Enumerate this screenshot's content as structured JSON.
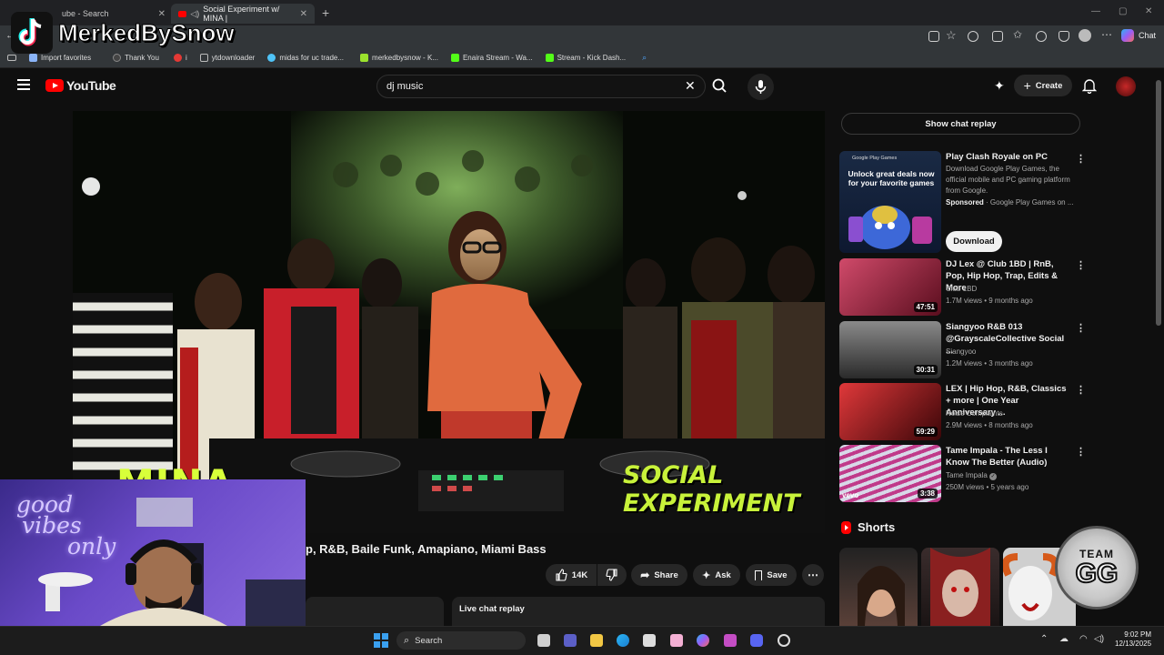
{
  "overlay": {
    "channel_name": "MerkedBySnow",
    "badge_line1": "TEAM",
    "badge_line2": "GG",
    "neon_line1": "good",
    "neon_line2": "vibes",
    "neon_line3": "only"
  },
  "browser": {
    "tabs": [
      {
        "label": "ube - Search"
      },
      {
        "label": "Social Experiment w/ MINA |"
      }
    ],
    "new_tab": "+",
    "chat_label": "Chat",
    "bookmarks": [
      {
        "label": "Import favorites",
        "color": "#8ab4f8"
      },
      {
        "label": "Thank You",
        "color": "#444444"
      },
      {
        "label": "i",
        "color": "#e53935"
      },
      {
        "label": "ytdownloader",
        "color": "#999999"
      },
      {
        "label": "midas for uc trade...",
        "color": "#4fc3f7"
      },
      {
        "label": "merkedbysnow - K...",
        "color": "#9be22d"
      },
      {
        "label": "Enaira Stream - Wa...",
        "color": "#53fc18"
      },
      {
        "label": "Stream - Kick Dash...",
        "color": "#53fc18"
      }
    ]
  },
  "youtube": {
    "logo_text": "YouTube",
    "search_value": "dj music",
    "create_label": "Create",
    "video_overlay_left": "MINA",
    "video_overlay_right": "SOCIAL EXPERIMENT",
    "video_title_partial": "p, R&B, Baile Funk, Amapiano, Miami Bass",
    "like_count": "14K",
    "share_label": "Share",
    "ask_label": "Ask",
    "save_label": "Save",
    "live_chat_replay": "Live chat replay",
    "show_chat_replay": "Show chat replay"
  },
  "ad": {
    "thumb_brand": "Google Play Games",
    "thumb_text": "Unlock great deals now for your favorite games",
    "title": "Play Clash Royale on PC",
    "description": "Download Google Play Games, the official mobile and PC gaming platform from Google.",
    "sponsored": "Sponsored",
    "advertiser": "· Google Play Games on ...",
    "button": "Download"
  },
  "recommendations": [
    {
      "title": "DJ Lex @ Club 1BD | RnB, Pop, Hip Hop, Trap, Edits & More",
      "channel": "Club 1BD",
      "meta": "1.7M views • 9 months ago",
      "duration": "47:51",
      "thumb_color": "#8a1c2c"
    },
    {
      "title": "Siangyoo R&B 013 @GrayscaleCollective Social ...",
      "channel": "Siangyoo",
      "meta": "1.2M views • 3 months ago",
      "duration": "30:31",
      "thumb_color": "#6a6a6a"
    },
    {
      "title": "LEX | Hip Hop, R&B, Classics + more | One Year Anniversary ...",
      "channel": "Noise Complaints",
      "meta": "2.9M views • 8 months ago",
      "duration": "59:29",
      "thumb_color": "#a0151c"
    },
    {
      "title": "Tame Impala - The Less I Know The Better (Audio)",
      "channel": "Tame Impala",
      "meta": "250M views • 5 years ago",
      "duration": "3:38",
      "thumb_color": "#b02a7a",
      "thumb_text": "vevo"
    }
  ],
  "shorts_label": "Shorts",
  "taskbar": {
    "search_label": "Search",
    "time": "9:02 PM",
    "date": "12/13/2025"
  }
}
